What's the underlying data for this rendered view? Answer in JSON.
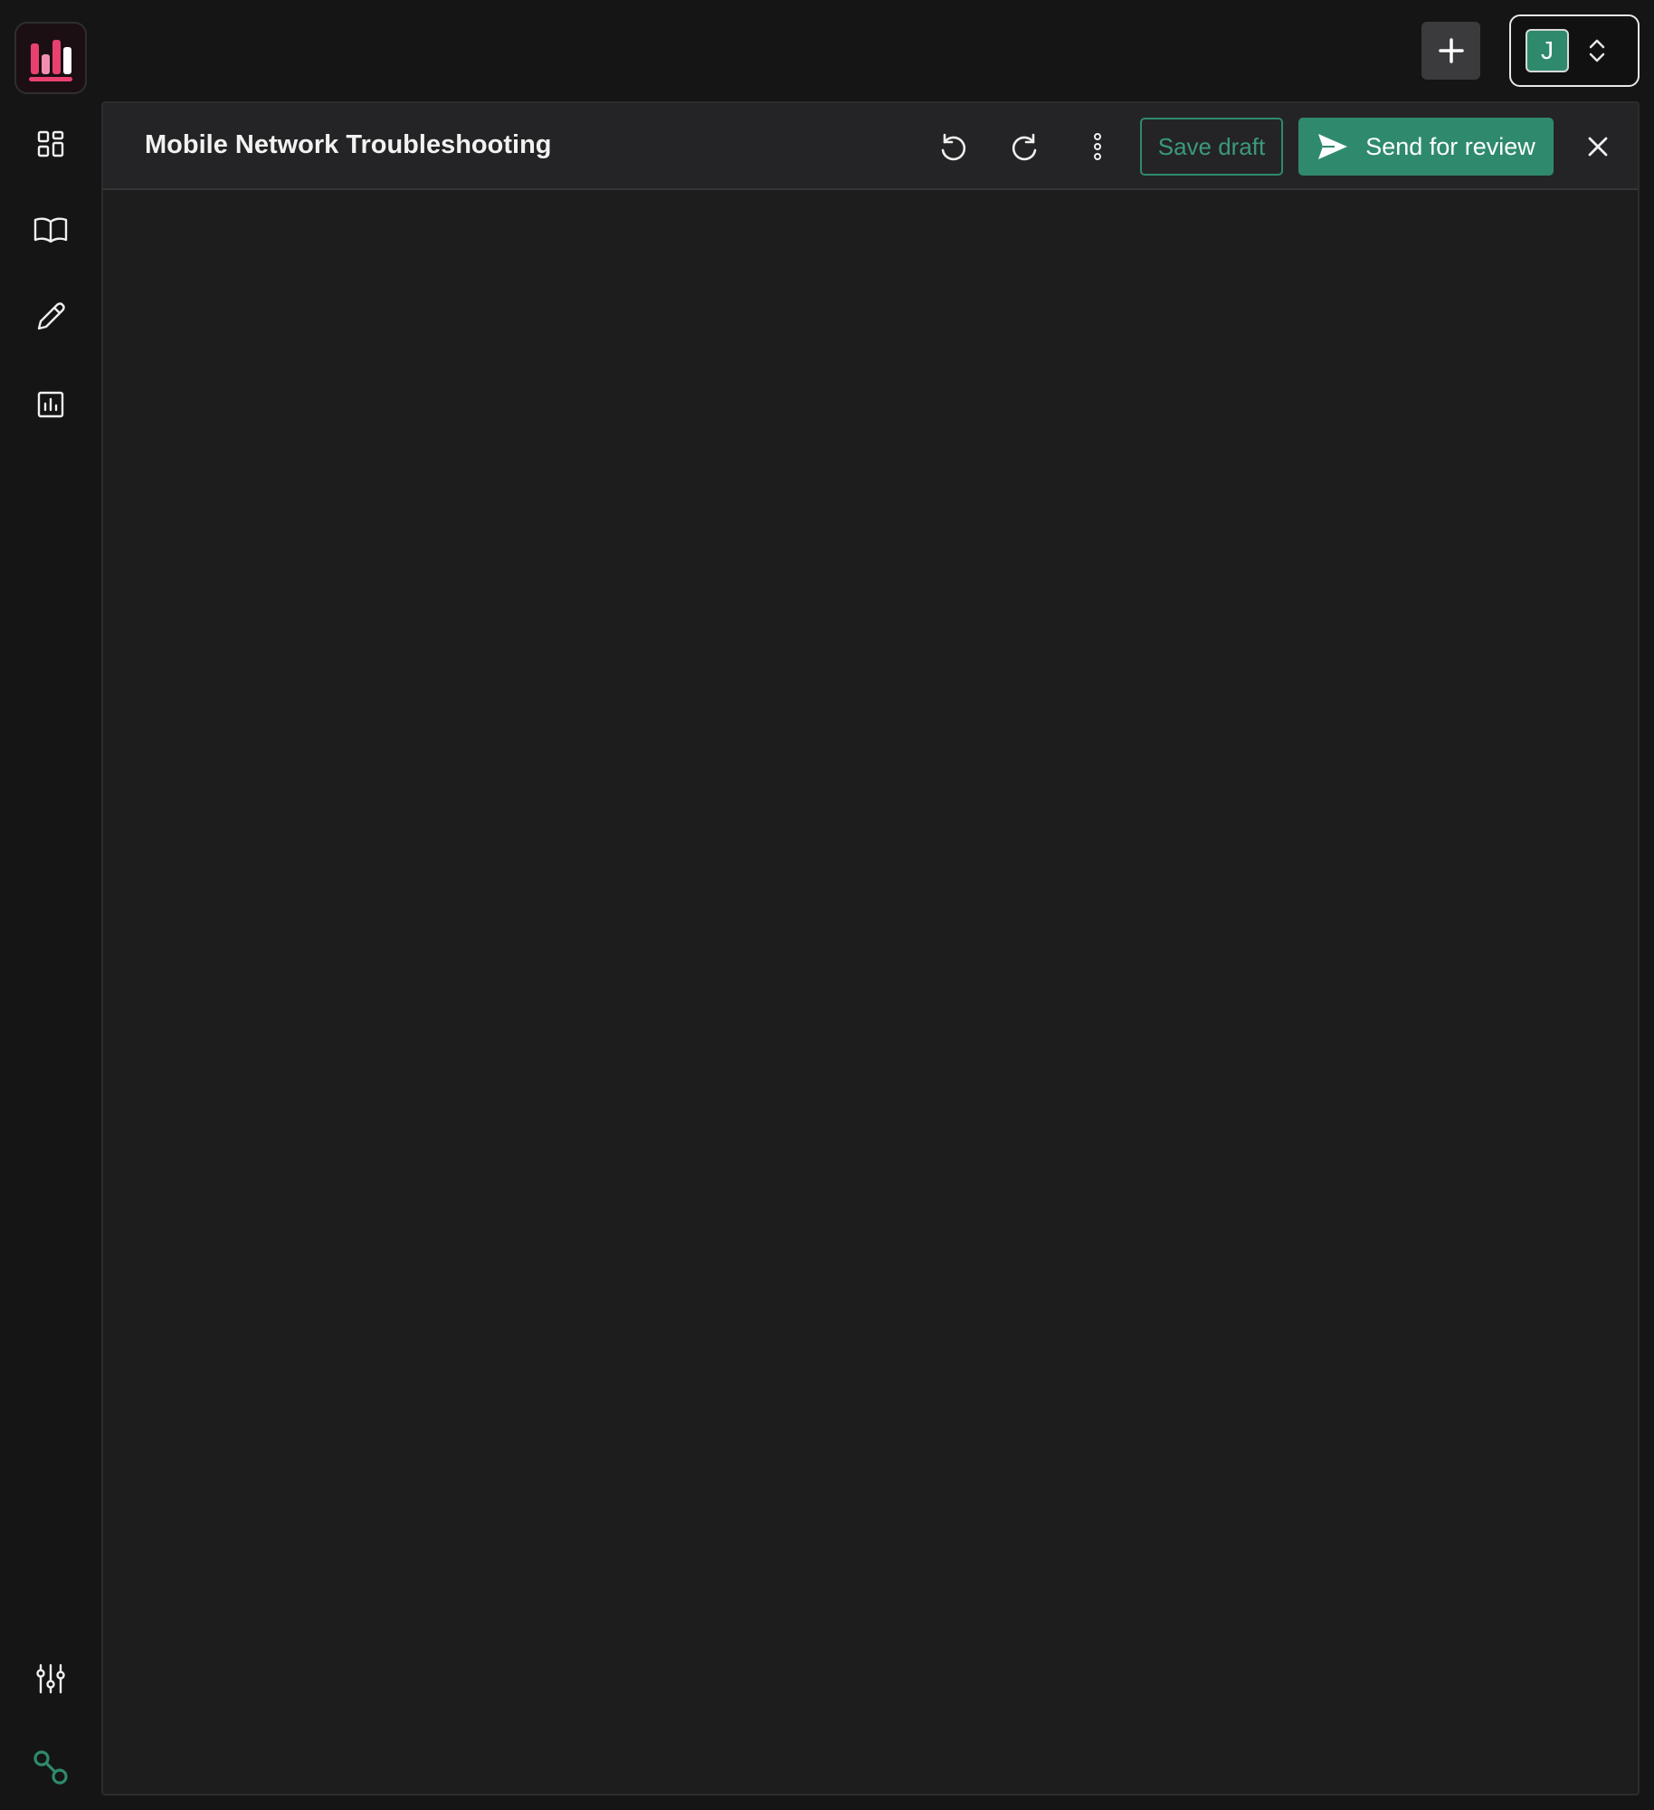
{
  "app": {
    "accent_color": "#2f8a6d",
    "logo_colors": [
      "#e8416f",
      "#f28fb0",
      "#ffffff"
    ]
  },
  "topbar": {
    "add_icon": "plus-icon",
    "account": {
      "avatar_initial": "J",
      "switch_icon": "chevron-up-down-icon"
    }
  },
  "sidebar": {
    "items": [
      {
        "icon": "dashboard-grid-icon"
      },
      {
        "icon": "book-open-icon"
      },
      {
        "icon": "pencil-icon"
      },
      {
        "icon": "bar-chart-icon"
      }
    ],
    "bottom_items": [
      {
        "icon": "sliders-icon"
      },
      {
        "icon": "connection-nodes-icon"
      }
    ]
  },
  "editor": {
    "title": "Mobile Network Troubleshooting",
    "toolbar": {
      "undo_icon": "undo-icon",
      "redo_icon": "redo-icon",
      "more_icon": "more-vertical-icon",
      "save_label": "Save draft",
      "send_label": "Send for review",
      "close_icon": "close-icon"
    }
  }
}
